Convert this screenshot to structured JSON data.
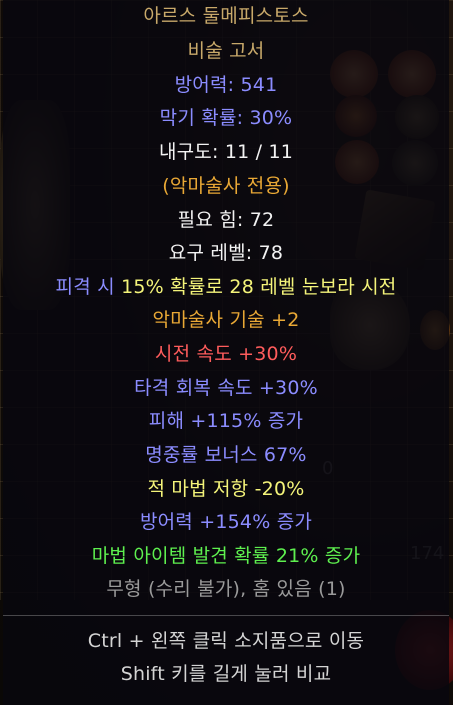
{
  "background": {
    "stat_0": "0",
    "stat_1744": "174"
  },
  "tooltip": {
    "name": "아르스 둘메피스토스",
    "base_type": "비술 고서",
    "armour": "방어력: 541",
    "block": "막기 확률: 30%",
    "durability": "내구도: 11 / 11",
    "class_restriction": "(악마술사 전용)",
    "req_strength": "필요 힘: 72",
    "req_level": "요구 레벨: 78",
    "mod_cast_on_hit": "피격 시 15% 확률로 28 레벨 눈보라 시전",
    "mod_skill": "악마술사 기술 +2",
    "mod_cast_speed": "시전 속도 +30%",
    "mod_hit_recovery": "타격 회복 속도 +30%",
    "mod_damage": "피해 +115% 증가",
    "mod_ar_bonus": "명중률 보너스 67%",
    "mod_magic_res": "적 마법 저항 -20%",
    "mod_armour": "방어력 +154% 증가",
    "mod_magic_find": "마법 아이템 발견 확률 21% 증가",
    "ethereal_sockets": "무형 (수리 불가), 홈 있음 (1)",
    "hint_ctrl": "Ctrl + 왼쪽 클릭 소지품으로 이동",
    "hint_shift": "Shift 키를 길게 눌러 비교"
  },
  "colors": {
    "unique": "#c8a96a",
    "white": "#f3f3f3",
    "blue": "#8b8cff",
    "gold": "#e9a835",
    "yellow": "#f4f47a",
    "red": "#ff5c5c",
    "green": "#5ef04f",
    "grey": "#9a9a9a"
  }
}
